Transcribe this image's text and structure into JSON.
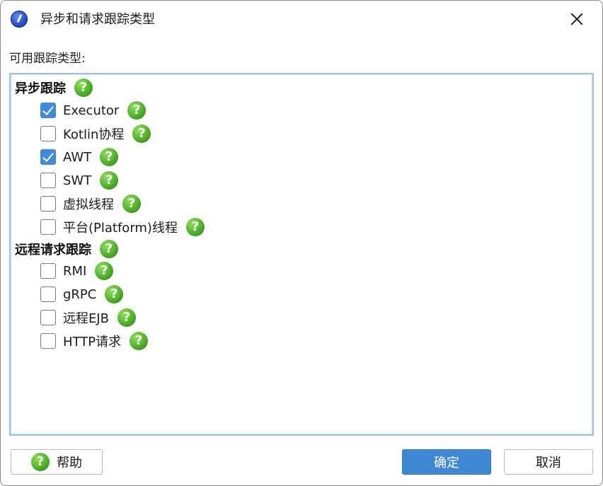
{
  "window": {
    "title": "异步和请求跟踪类型"
  },
  "section_label": "可用跟踪类型:",
  "groups": [
    {
      "title": "异步跟踪",
      "items": [
        {
          "label": "Executor",
          "checked": true
        },
        {
          "label": "Kotlin协程",
          "checked": false
        },
        {
          "label": "AWT",
          "checked": true
        },
        {
          "label": "SWT",
          "checked": false
        },
        {
          "label": "虚拟线程",
          "checked": false
        },
        {
          "label": "平台(Platform)线程",
          "checked": false
        }
      ]
    },
    {
      "title": "远程请求跟踪",
      "items": [
        {
          "label": "RMI",
          "checked": false
        },
        {
          "label": "gRPC",
          "checked": false
        },
        {
          "label": "远程EJB",
          "checked": false
        },
        {
          "label": "HTTP请求",
          "checked": false
        }
      ]
    }
  ],
  "help_glyph": "?",
  "buttons": {
    "help": "帮助",
    "ok": "确定",
    "cancel": "取消"
  },
  "icons": {
    "app": "app-logo-icon",
    "close": "close-icon",
    "help": "help-icon"
  },
  "colors": {
    "accent": "#3f88d4",
    "checkbox_checked": "#3d8ae0",
    "help_icon": "#4fb02a",
    "list_border": "#9cc3ea"
  }
}
